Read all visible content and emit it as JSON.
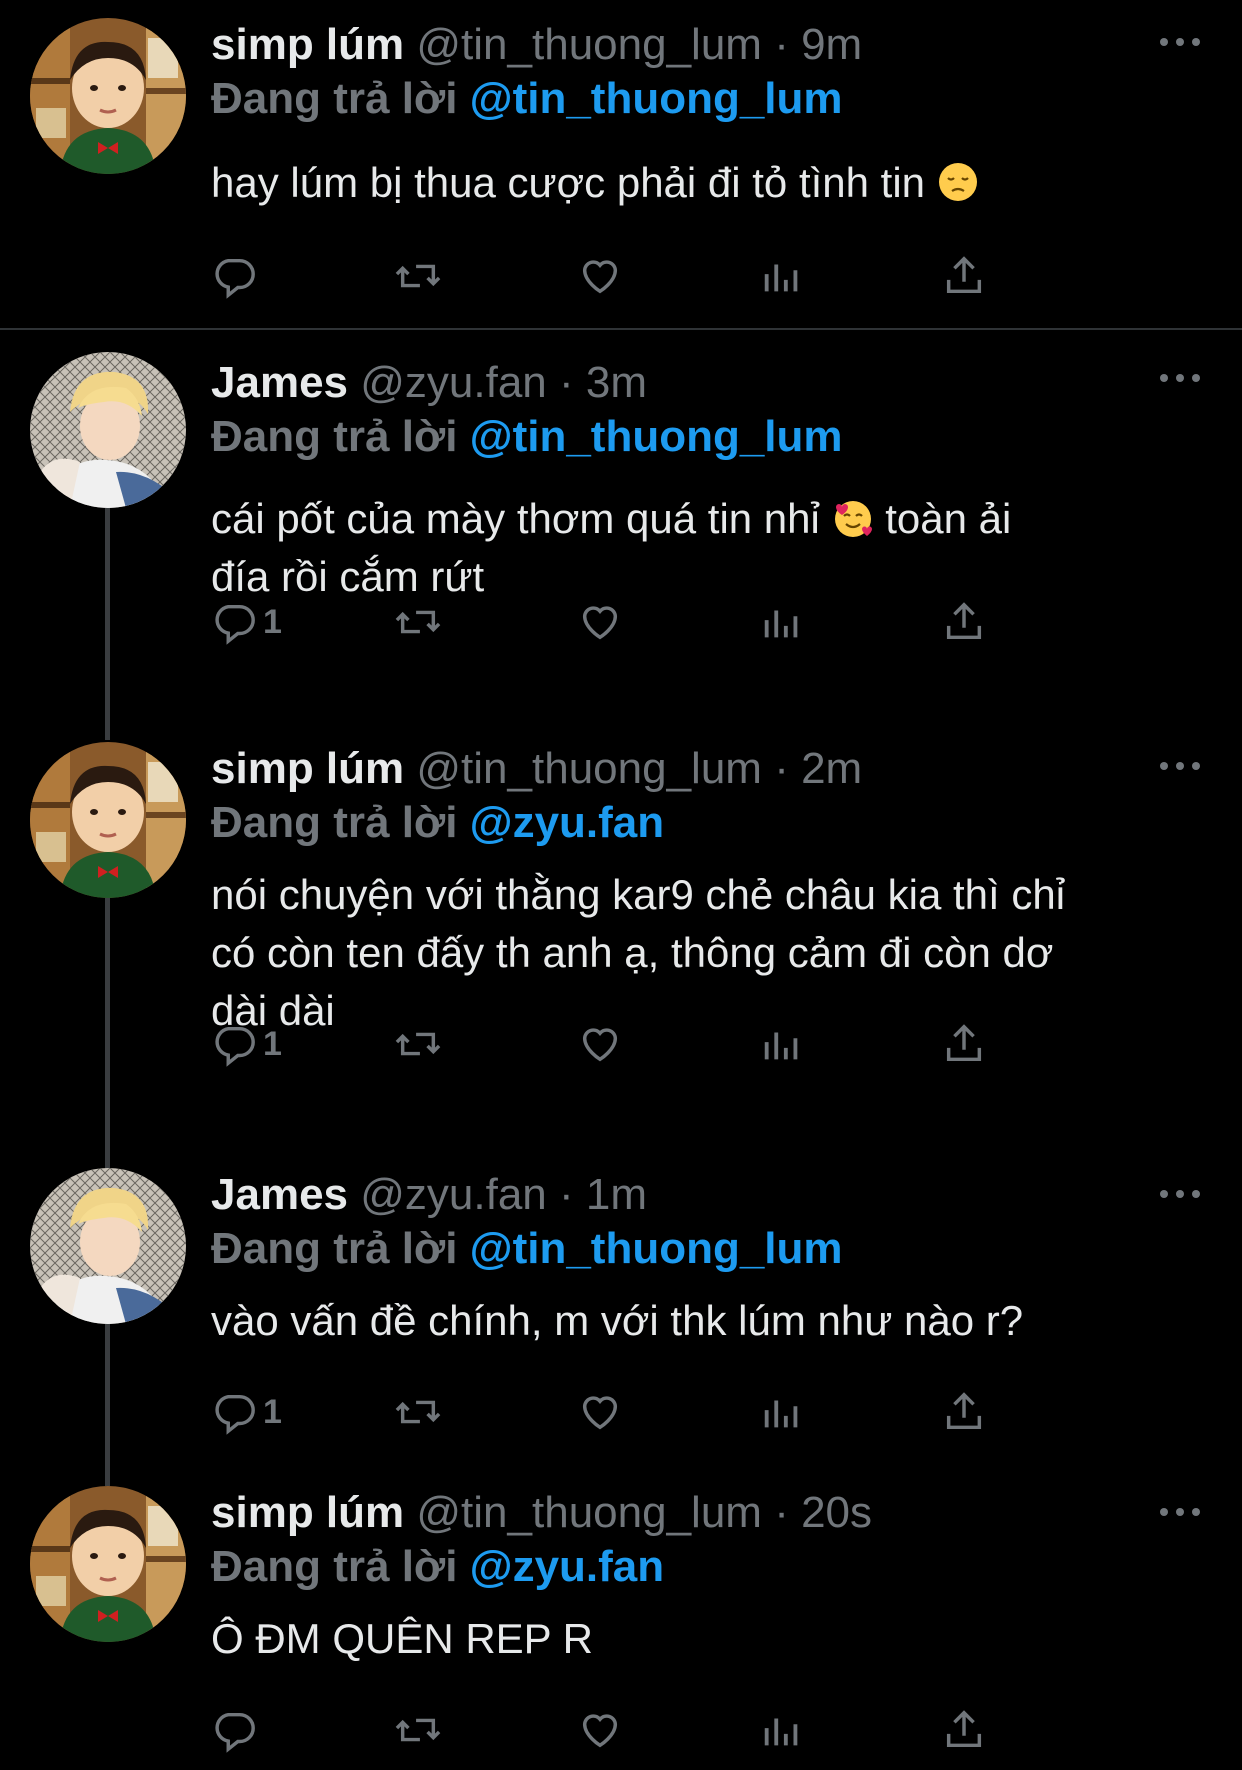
{
  "tweets": [
    {
      "user": "simp lúm",
      "handle": "@tin_thuong_lum",
      "time": "9m",
      "reply_label": "Đang trả lời",
      "reply_to": "@tin_thuong_lum",
      "text": "hay lúm bị thua cược phải đi tỏ tình tin",
      "emoji": "pensive-face",
      "reply_count": "",
      "avatar": "boy-avatar"
    },
    {
      "user": "James",
      "handle": "@zyu.fan",
      "time": "3m",
      "reply_label": "Đang trả lời",
      "reply_to": "@tin_thuong_lum",
      "text_a": "cái pốt của mày thơm quá tin nhỉ",
      "emoji": "smiling-face-with-hearts",
      "text_b": " toàn ải",
      "text_c": "đía rồi cắm rứt",
      "reply_count": "1",
      "avatar": "blond-avatar"
    },
    {
      "user": "simp lúm",
      "handle": "@tin_thuong_lum",
      "time": "2m",
      "reply_label": "Đang trả lời",
      "reply_to": "@zyu.fan",
      "lines": [
        "nói chuyện với thằng kar9 chẻ châu kia thì chỉ",
        "có còn ten đấy th anh ạ, thông cảm đi còn dơ",
        "dài dài"
      ],
      "reply_count": "1",
      "avatar": "boy-avatar"
    },
    {
      "user": "James",
      "handle": "@zyu.fan",
      "time": "1m",
      "reply_label": "Đang trả lời",
      "reply_to": "@tin_thuong_lum",
      "text": "vào vấn đề chính, m với thk lúm như nào r?",
      "reply_count": "1",
      "avatar": "blond-avatar"
    },
    {
      "user": "simp lúm",
      "handle": "@tin_thuong_lum",
      "time": "20s",
      "reply_label": "Đang trả lời",
      "reply_to": "@zyu.fan",
      "text": "Ô ĐM QUÊN REP R",
      "reply_count": "",
      "avatar": "boy-avatar"
    }
  ],
  "separator": "·",
  "icons": [
    "reply-icon",
    "retweet-icon",
    "like-icon",
    "views-icon",
    "share-icon",
    "more-icon"
  ],
  "colors": {
    "background": "#000000",
    "text": "#e7e9ea",
    "muted": "#71767b",
    "mention": "#1d9bf0",
    "divider": "#2f3336"
  }
}
